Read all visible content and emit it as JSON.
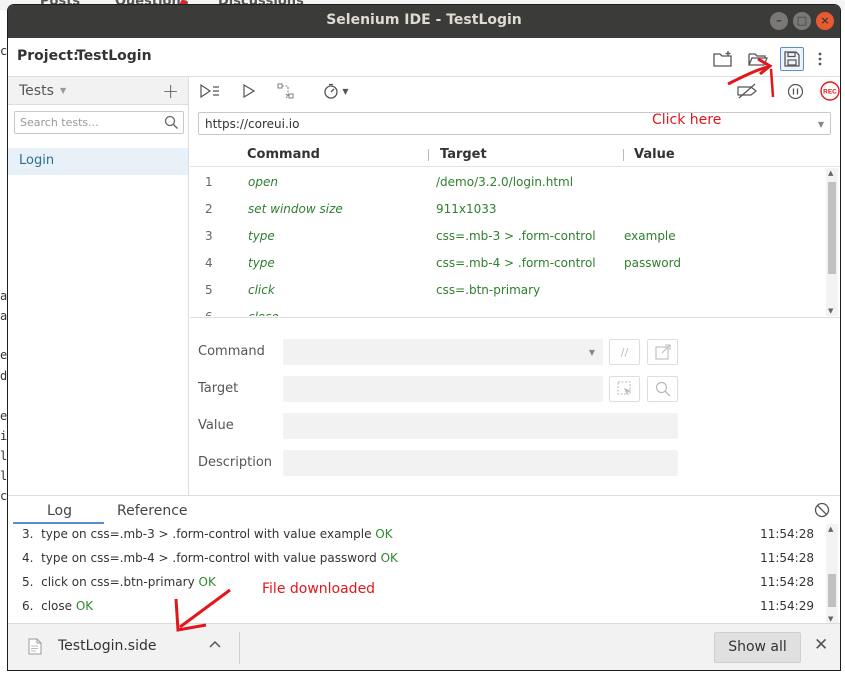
{
  "background_page": {
    "tabs": [
      "Posts",
      "Questions",
      "Discussions"
    ],
    "left_fragments": [
      "ci",
      "a",
      "a",
      "es",
      "de",
      "er",
      "i",
      "l_",
      "l_",
      "c"
    ]
  },
  "window": {
    "title": "Selenium IDE - TestLogin",
    "buttons": {
      "minimize": "–",
      "maximize": "□",
      "close": "×"
    }
  },
  "project": {
    "label": "Project:",
    "name": "TestLogin",
    "icons": [
      "new-folder-icon",
      "open-folder-icon",
      "save-icon",
      "more-vertical-icon"
    ]
  },
  "sidebar": {
    "header": "Tests",
    "add": "+",
    "search_placeholder": "Search tests...",
    "tests": [
      "Login"
    ]
  },
  "toolbar": {
    "icons": [
      "run-all-tests-icon",
      "run-current-test-icon",
      "step-over-icon",
      "speed-icon",
      "disable-breakpoints-icon",
      "pause-icon",
      "record-icon"
    ],
    "record_label": "REC"
  },
  "url": {
    "value": "https://coreui.io"
  },
  "commands_table": {
    "headers": [
      "Command",
      "Target",
      "Value"
    ],
    "rows": [
      {
        "num": "1",
        "command": "open",
        "target": "/demo/3.2.0/login.html",
        "value": ""
      },
      {
        "num": "2",
        "command": "set window size",
        "target": "911x1033",
        "value": ""
      },
      {
        "num": "3",
        "command": "type",
        "target": "css=.mb-3 > .form-control",
        "value": "example"
      },
      {
        "num": "4",
        "command": "type",
        "target": "css=.mb-4 > .form-control",
        "value": "password"
      },
      {
        "num": "5",
        "command": "click",
        "target": "css=.btn-primary",
        "value": ""
      },
      {
        "num": "6",
        "command": "close",
        "target": "",
        "value": ""
      }
    ]
  },
  "editor": {
    "labels": {
      "command": "Command",
      "target": "Target",
      "value": "Value",
      "description": "Description"
    },
    "comment_btn": "//",
    "open_btn": "↗"
  },
  "bottom_panel": {
    "tabs": [
      "Log",
      "Reference"
    ],
    "log": [
      {
        "num": "3.",
        "text": "type on css=.mb-3 > .form-control with value example",
        "status": "OK",
        "time": "11:54:28"
      },
      {
        "num": "4.",
        "text": "type on css=.mb-4 > .form-control with value password",
        "status": "OK",
        "time": "11:54:28"
      },
      {
        "num": "5.",
        "text": "click on css=.btn-primary",
        "status": "OK",
        "time": "11:54:28"
      },
      {
        "num": "6.",
        "text": "close",
        "status": "OK",
        "time": "11:54:29"
      }
    ]
  },
  "download_bar": {
    "file": "TestLogin.side",
    "chevron": "^",
    "show_all": "Show all",
    "close": "✕"
  },
  "annotations": {
    "click_here": "Click here",
    "file_downloaded": "File downloaded",
    "color": "#e3161b"
  },
  "colors": {
    "accent": "#5a8dd3",
    "command_green": "#2f7f2f",
    "record_red": "#e3161b",
    "selected_test_bg": "#e8f0f8",
    "titlebar": "#3b3b39"
  }
}
